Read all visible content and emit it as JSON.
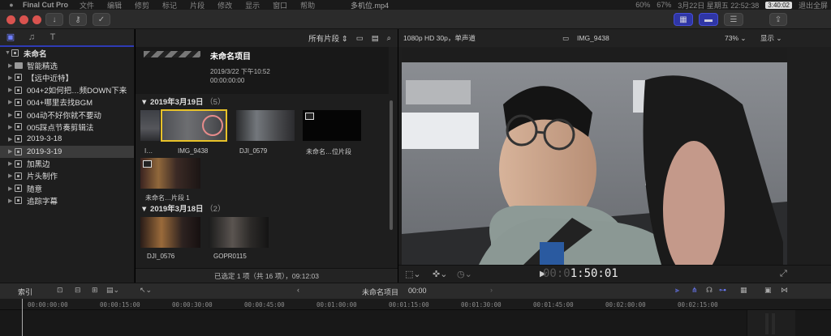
{
  "menubar": {
    "app_name": "Final Cut Pro",
    "menus": [
      "文件",
      "编辑",
      "修剪",
      "标记",
      "片段",
      "修改",
      "显示",
      "窗口",
      "帮助"
    ],
    "file_title": "多机位.mp4",
    "battery": "60%",
    "battery2": "67%",
    "date_time": "3月22日 星期五 22:52:38",
    "rec_time": "3:40:02",
    "exit_fullscreen": "退出全屏"
  },
  "sidebar": {
    "root_label": "未命名",
    "items": [
      {
        "label": "智能精选",
        "type": "folder"
      },
      {
        "label": "【远中近特】",
        "type": "event"
      },
      {
        "label": "004+2如何把…频DOWN下来",
        "type": "event"
      },
      {
        "label": "004+哪里去找BGM",
        "type": "event"
      },
      {
        "label": "004动不好你就不要动",
        "type": "event"
      },
      {
        "label": "005踩点节奏剪辑法",
        "type": "event"
      },
      {
        "label": "2019-3-18",
        "type": "event"
      },
      {
        "label": "2019-3-19",
        "type": "event",
        "selected": true
      },
      {
        "label": "加黑边",
        "type": "event"
      },
      {
        "label": "片头制作",
        "type": "event"
      },
      {
        "label": "随意",
        "type": "event"
      },
      {
        "label": "追踪字幕",
        "type": "event"
      }
    ]
  },
  "browser": {
    "filter_label": "所有片段",
    "project": {
      "title": "未命名项目",
      "date": "2019/3/22 下午10:52",
      "duration": "00:00:00:00"
    },
    "sections": [
      {
        "title": "2019年3月19日",
        "count": "（5）",
        "clips": [
          "I…",
          "IMG_9438",
          "DJI_0579",
          "未命名…位片段",
          "未命名…片段 1"
        ]
      },
      {
        "title": "2019年3月18日",
        "count": "（2）",
        "clips": [
          "DJI_0576",
          "GOPR0115"
        ]
      }
    ],
    "footer": "已选定 1 项（共 16 项），09:12:03"
  },
  "viewer": {
    "format": "1080p HD 30p，单声道",
    "clip_name": "IMG_9438",
    "zoom": "73%",
    "display_label": "显示",
    "timecode_dim": "00:0",
    "timecode": "1:50:01"
  },
  "timeline": {
    "index_label": "索引",
    "project_name": "未命名项目",
    "project_time": "00:00",
    "ruler_ticks": [
      "00:00:00:00",
      "00:00:15:00",
      "00:00:30:00",
      "00:00:45:00",
      "00:01:00:00",
      "00:01:15:00",
      "00:01:30:00",
      "00:01:45:00",
      "00:02:00:00",
      "00:02:15:00"
    ]
  },
  "colors": {
    "accent": "#2f36a6",
    "selection": "#e8c229",
    "traffic_red": "#d9534f"
  }
}
